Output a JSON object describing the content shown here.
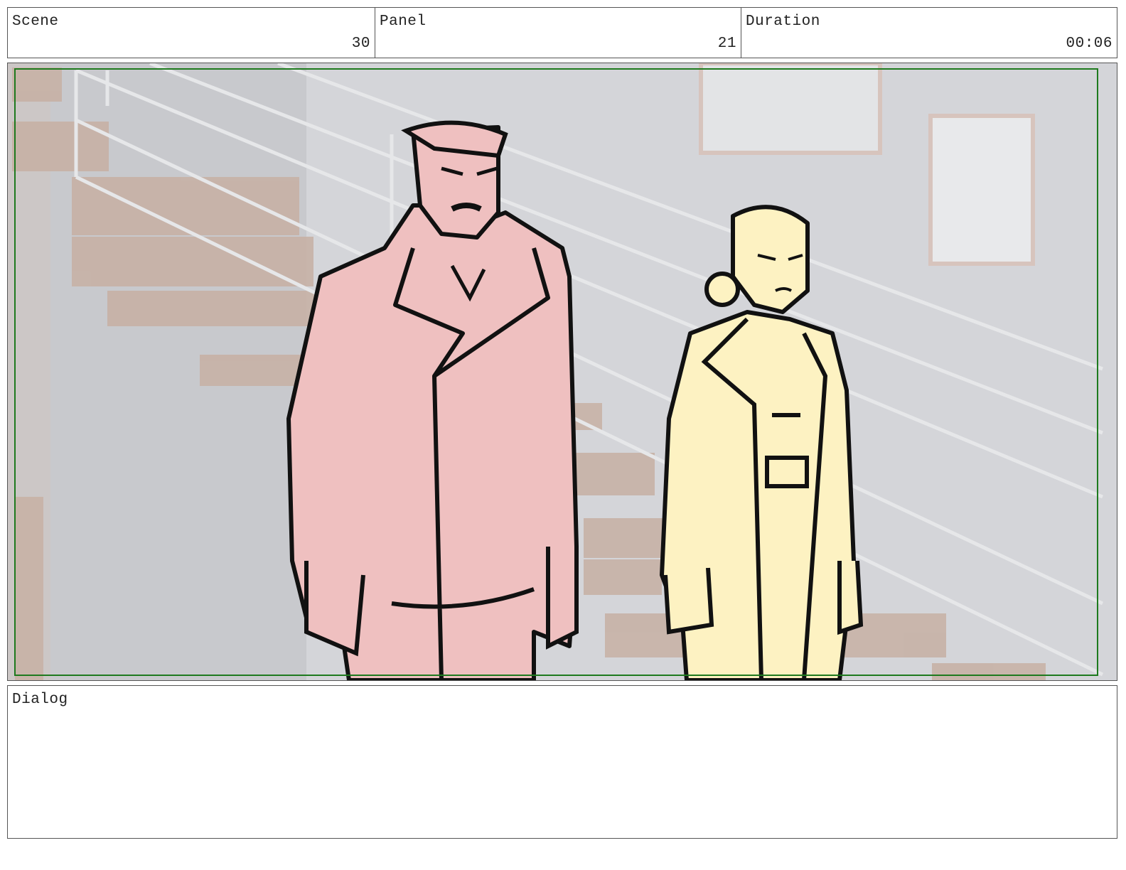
{
  "header": {
    "scene_label": "Scene",
    "scene_value": "30",
    "panel_label": "Panel",
    "panel_value": "21",
    "duration_label": "Duration",
    "duration_value": "00:06"
  },
  "dialog": {
    "label": "Dialog",
    "text": ""
  },
  "colors": {
    "safe_frame": "#1e7a1e",
    "man_fill": "#efc0c0",
    "woman_fill": "#fdf2c2",
    "wall": "#d6d7da",
    "stairs": "#c9b3a6"
  }
}
